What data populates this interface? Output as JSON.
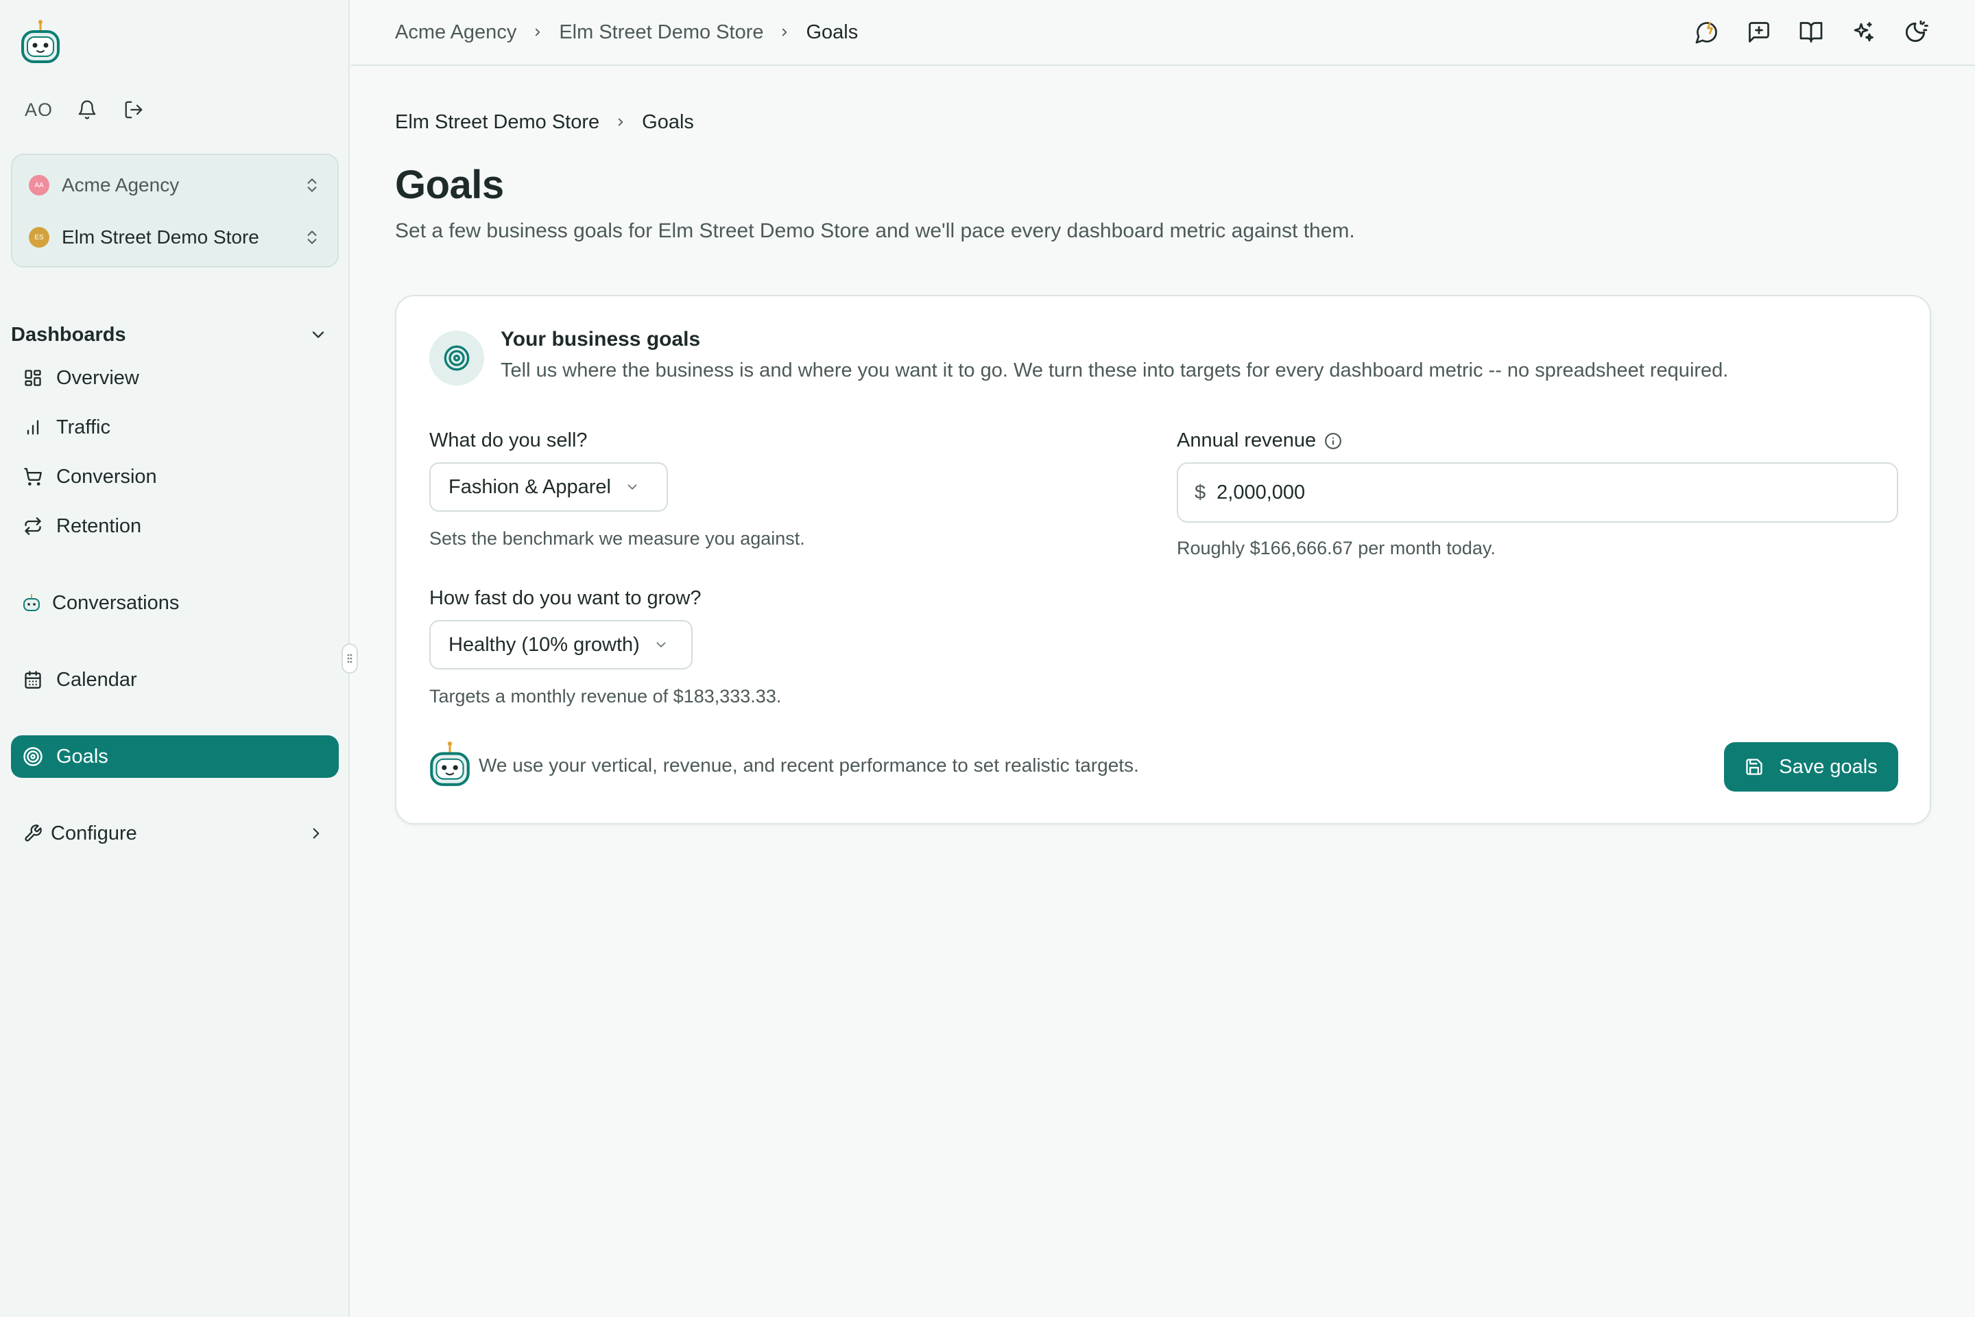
{
  "colors": {
    "brand": "#0d7d74",
    "background": "#f6f9f8",
    "sidebar_bg": "#f1f6f5",
    "agency_avatar": "#ef8d9c",
    "store_avatar": "#d3a23b"
  },
  "sidebar": {
    "user_initials": "AO",
    "user_icons": [
      "bell-icon",
      "logout-icon"
    ],
    "agency": {
      "avatar_initials": "AA",
      "name": "Acme Agency"
    },
    "store": {
      "avatar_initials": "ES",
      "name": "Elm Street Demo Store"
    },
    "dashboards_heading": "Dashboards",
    "dashboards": [
      {
        "label": "Overview",
        "icon": "grid-icon"
      },
      {
        "label": "Traffic",
        "icon": "bar-chart-icon"
      },
      {
        "label": "Conversion",
        "icon": "cart-icon"
      },
      {
        "label": "Retention",
        "icon": "repeat-icon"
      }
    ],
    "conversations": {
      "label": "Conversations",
      "icon": "bot-icon"
    },
    "calendar": {
      "label": "Calendar",
      "icon": "calendar-icon"
    },
    "goals": {
      "label": "Goals",
      "icon": "target-icon",
      "active": true
    },
    "configure": {
      "label": "Configure",
      "icon": "wrench-icon"
    }
  },
  "topbar": {
    "breadcrumbs": [
      "Acme Agency",
      "Elm Street Demo Store",
      "Goals"
    ],
    "actions": [
      "chat-spark-icon",
      "message-plus-icon",
      "book-icon",
      "sparkles-icon",
      "theme-toggle-icon"
    ]
  },
  "page": {
    "breadcrumbs": [
      "Elm Street Demo Store",
      "Goals"
    ],
    "title": "Goals",
    "subtitle": "Set a few business goals for Elm Street Demo Store and we'll pace every dashboard metric against them."
  },
  "card": {
    "title": "Your business goals",
    "description": "Tell us where the business is and where you want it to go. We turn these into targets for every dashboard metric -- no spreadsheet required.",
    "vertical": {
      "label": "What do you sell?",
      "value": "Fashion & Apparel",
      "helper": "Sets the benchmark we measure you against."
    },
    "growth": {
      "label": "How fast do you want to grow?",
      "value": "Healthy (10% growth)",
      "helper": "Targets a monthly revenue of $183,333.33."
    },
    "revenue": {
      "label": "Annual revenue",
      "prefix": "$",
      "value": "2,000,000",
      "helper": "Roughly $166,666.67 per month today."
    },
    "footer_note": "We use your vertical, revenue, and recent performance to set realistic targets.",
    "save_label": "Save goals"
  }
}
